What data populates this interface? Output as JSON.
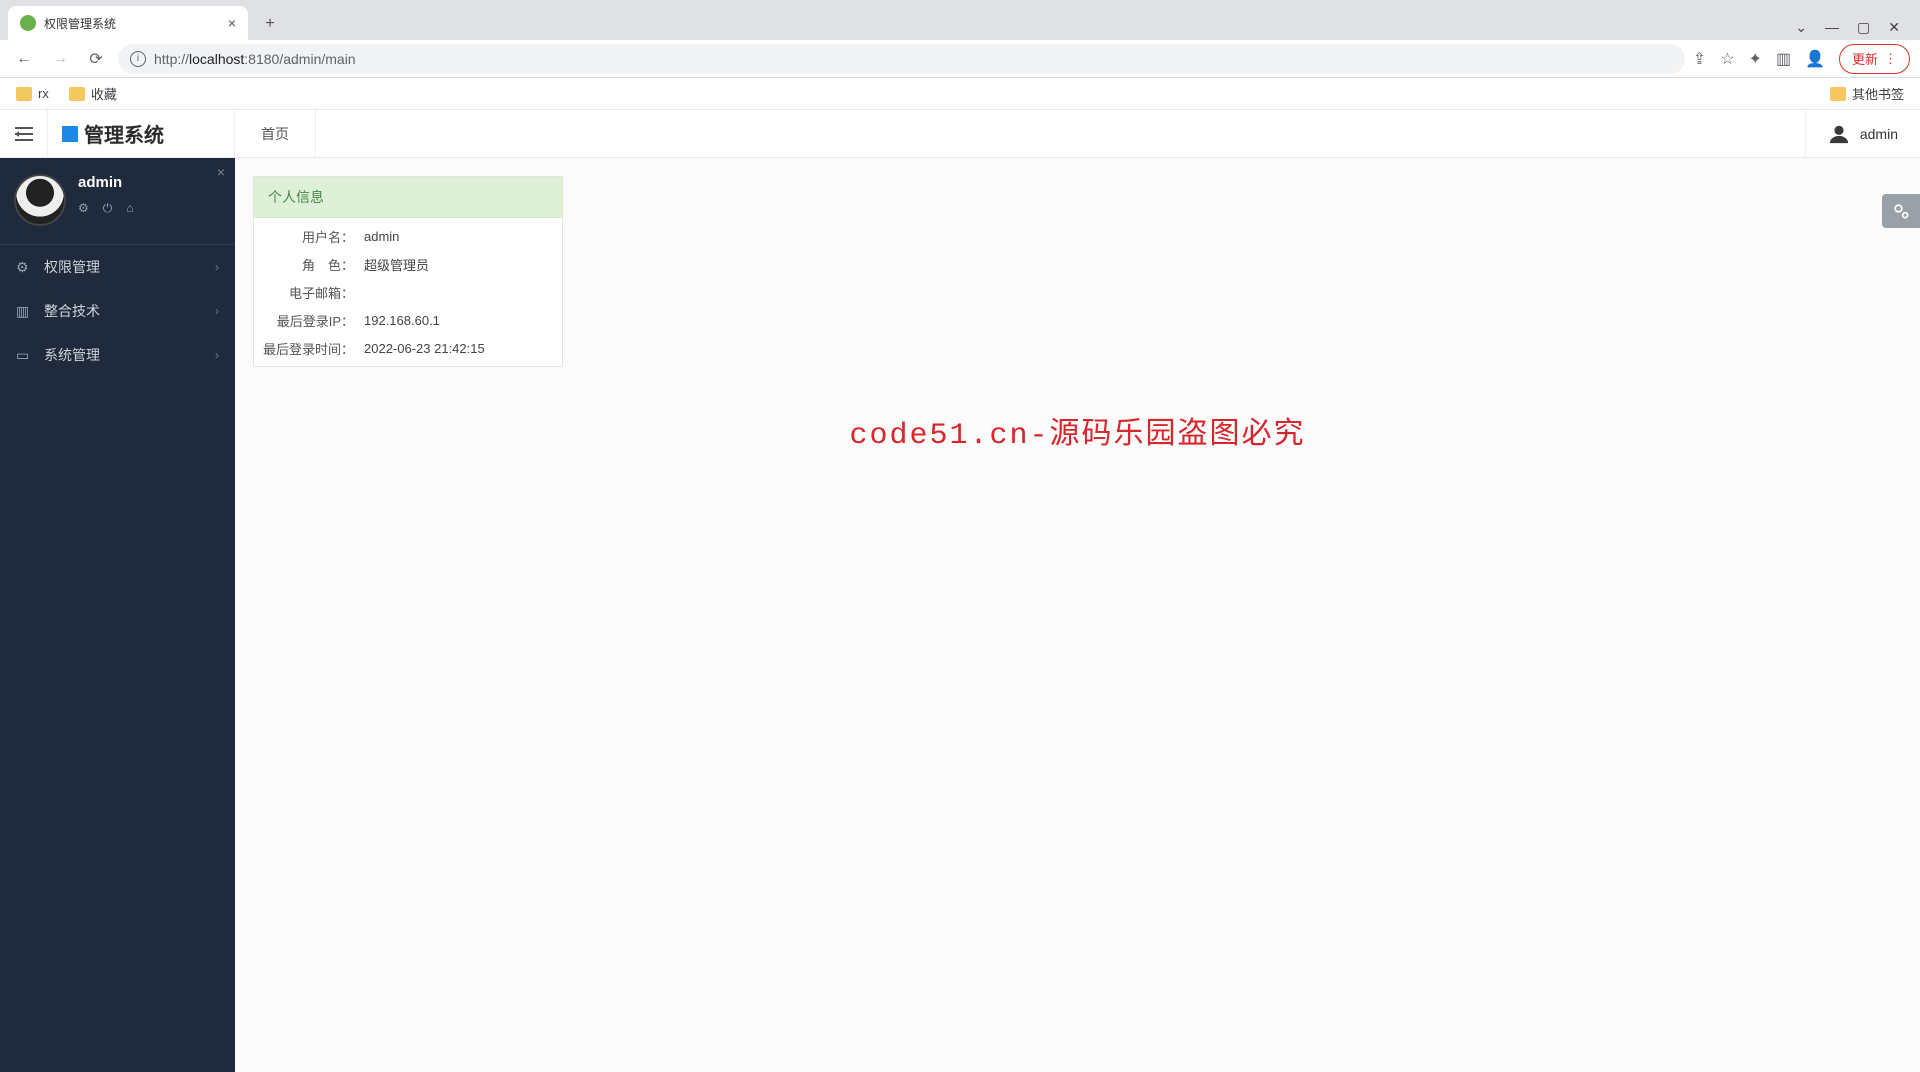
{
  "browser": {
    "tab_title": "权限管理系统",
    "url_display": "http://localhost:8180/admin/main",
    "update_label": "更新",
    "bookmarks": {
      "rx": "rx",
      "fav": "收藏",
      "other": "其他书签"
    }
  },
  "header": {
    "brand": "管理系统",
    "crumb": "首页",
    "user": "admin"
  },
  "sidebar": {
    "user_name": "admin",
    "items": [
      {
        "label": "权限管理"
      },
      {
        "label": "整合技术"
      },
      {
        "label": "系统管理"
      }
    ]
  },
  "panel": {
    "title": "个人信息",
    "rows": {
      "username_label": "用户名：",
      "username_value": "admin",
      "role_label": "角　色：",
      "role_value": "超级管理员",
      "email_label": "电子邮箱：",
      "email_value": "",
      "ip_label": "最后登录IP：",
      "ip_value": "192.168.60.1",
      "time_label": "最后登录时间：",
      "time_value": "2022-06-23 21:42:15"
    }
  },
  "watermark": "code51.cn-源码乐园盗图必究"
}
